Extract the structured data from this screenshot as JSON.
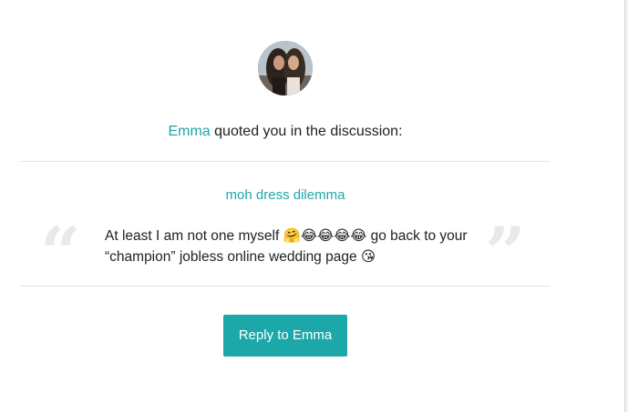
{
  "notification": {
    "user_name": "Emma",
    "action_text": " quoted you in the discussion:",
    "discussion_title": "moh dress dilemma",
    "open_quote": "“",
    "close_quote": "”",
    "quote_text": "At least I am not one myself 🤗😂😂😂😂 go back to your “champion” jobless online wedding page 😘",
    "reply_button_label": "Reply to Emma"
  },
  "colors": {
    "accent": "#1ca7a9",
    "text": "#222222",
    "divider": "#e2e2e2",
    "quote_mark": "#e9e9e9"
  },
  "icons": {
    "avatar": "user-avatar-photo"
  }
}
